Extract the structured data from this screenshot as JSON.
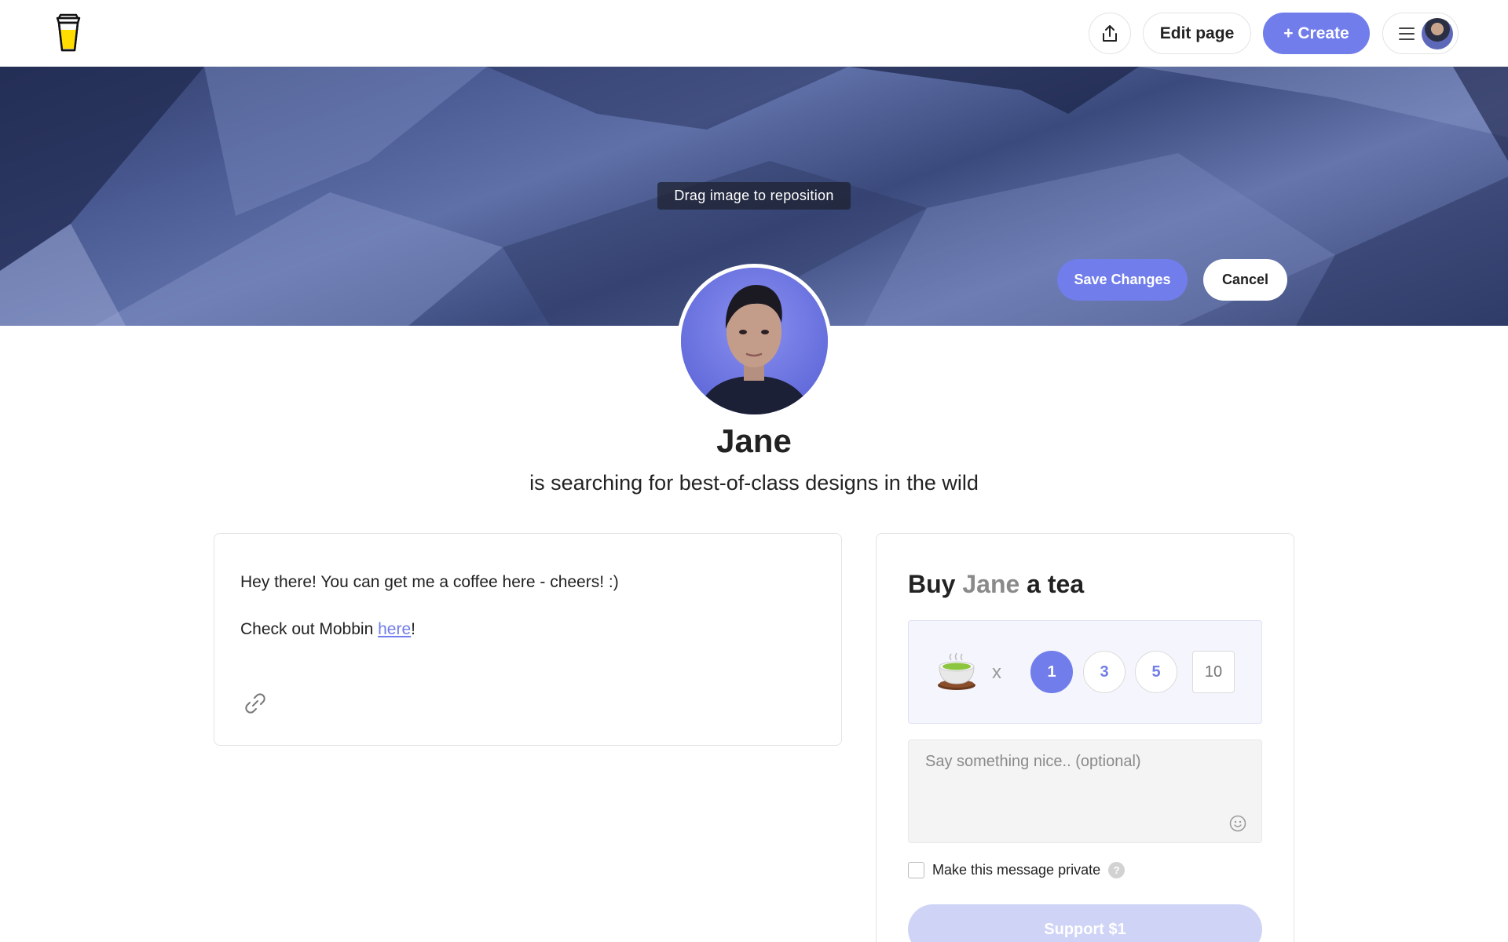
{
  "header": {
    "logo_icon": "cup-logo-icon",
    "share_icon": "share-upload-icon",
    "edit_label": "Edit page",
    "create_label": "+ Create",
    "menu_icon": "hamburger-menu-icon"
  },
  "cover": {
    "drag_hint": "Drag image to reposition",
    "save_label": "Save Changes",
    "cancel_label": "Cancel"
  },
  "profile": {
    "name": "Jane",
    "tagline": "is searching for best-of-class designs in the wild"
  },
  "about": {
    "line1": "Hey there! You can get me a coffee here - cheers! :)",
    "line2_prefix": "Check out Mobbin ",
    "line2_link": "here",
    "line2_suffix": "!",
    "link_icon": "link-chain-icon"
  },
  "support": {
    "title_prefix": "Buy ",
    "title_name": "Jane",
    "title_suffix": " a tea",
    "item_icon": "tea-cup-icon",
    "multiplier": "x",
    "options": [
      "1",
      "3",
      "5"
    ],
    "selected": "1",
    "custom_placeholder": "10",
    "message_placeholder": "Say something nice.. (optional)",
    "emoji_icon": "smiley-icon",
    "private_label": "Make this message private",
    "help_glyph": "?",
    "button_label": "Support $1"
  },
  "colors": {
    "accent": "#717dea",
    "accent_light": "#cfd3f6",
    "text": "#222222",
    "muted": "#8a8a8a"
  }
}
